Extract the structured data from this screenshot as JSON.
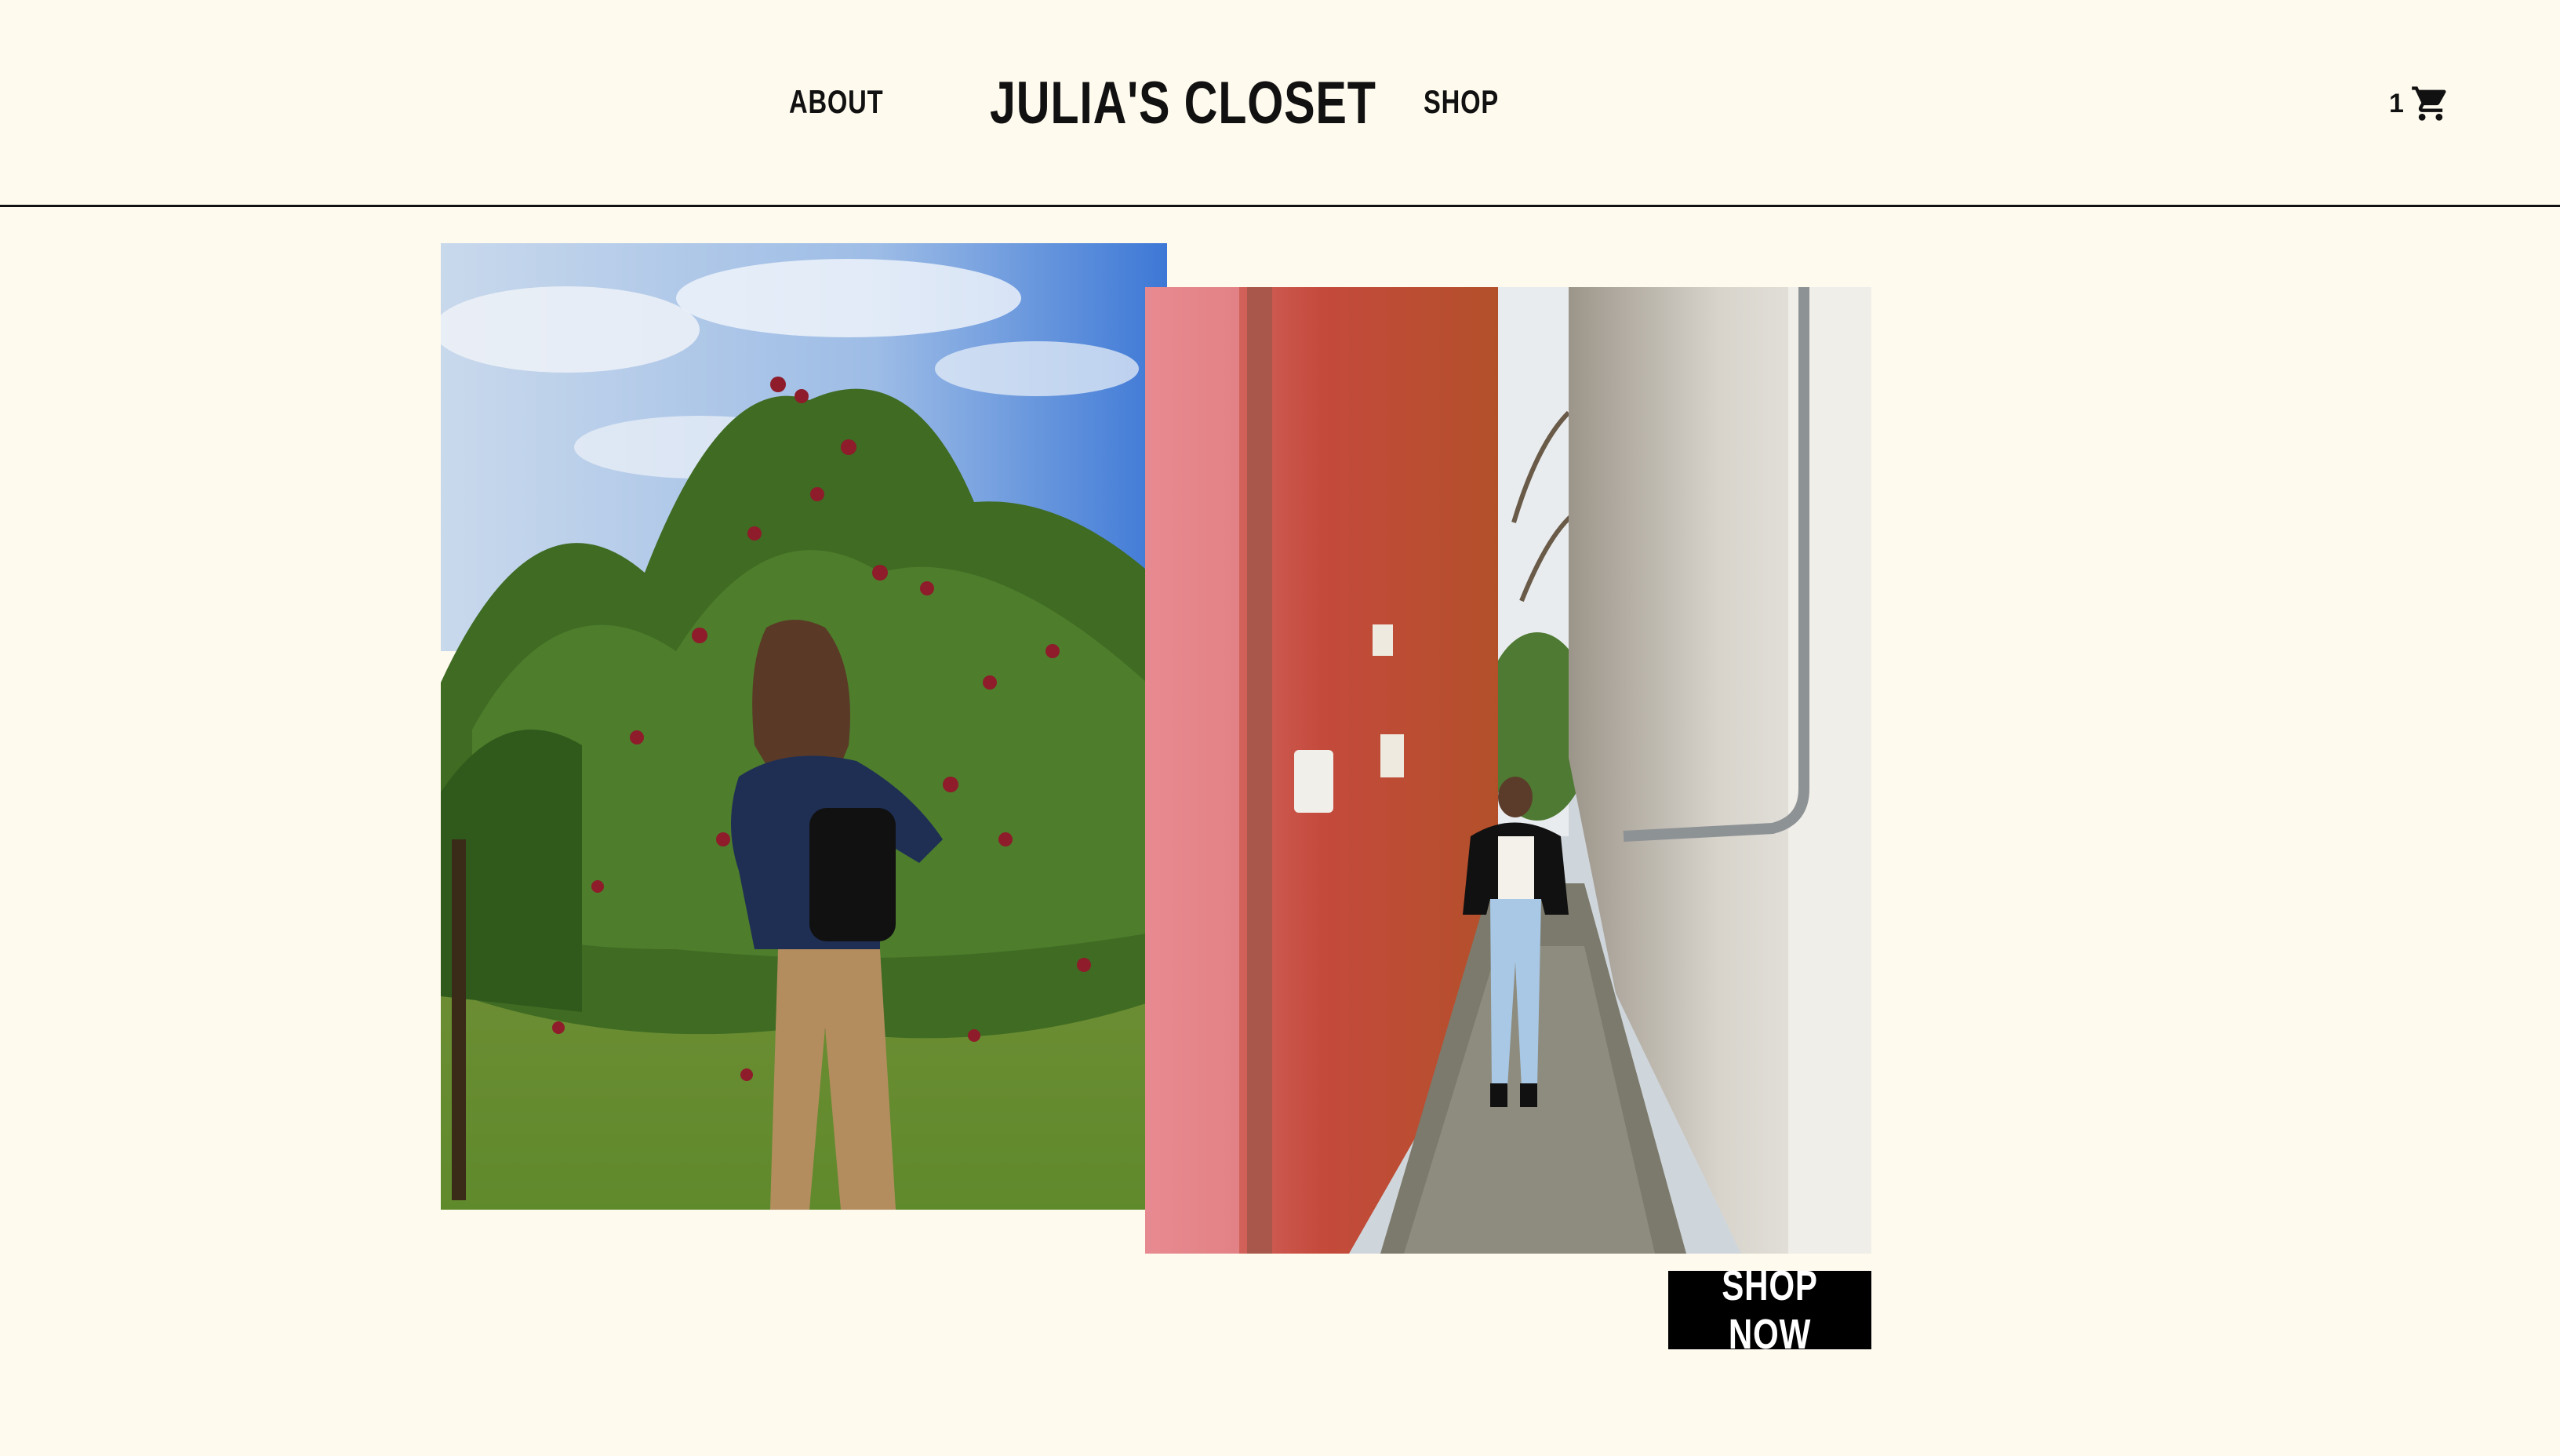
{
  "header": {
    "nav_about": "ABOUT",
    "logo": "JULIA'S CLOSET",
    "nav_shop": "SHOP",
    "cart_count": "1",
    "cart_icon": "shopping-cart-icon"
  },
  "hero": {
    "shop_now_label": "SHOP NOW"
  },
  "colors": {
    "background": "#fefaee",
    "text": "#111111",
    "button_bg": "#000000",
    "button_text": "#ffffff"
  }
}
